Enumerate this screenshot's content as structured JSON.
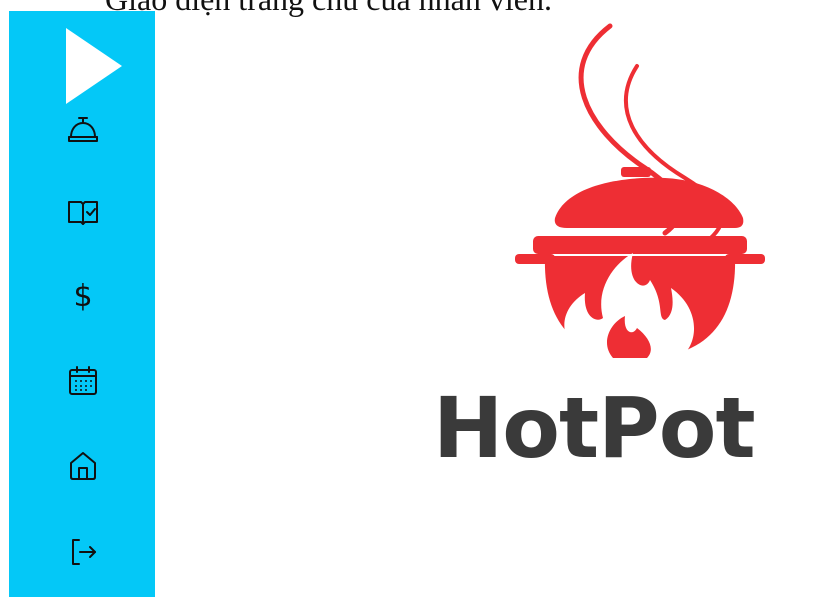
{
  "caption": "Giao diện trang chủ của nhân viên.",
  "sidebar": {
    "background": "#04c8f7",
    "toggle": {
      "icon": "play-triangle-icon"
    },
    "items": [
      {
        "name": "service",
        "icon": "service-bell-icon"
      },
      {
        "name": "menu",
        "icon": "menu-book-check-icon"
      },
      {
        "name": "payment",
        "icon": "dollar-sign-icon",
        "glyph": "$"
      },
      {
        "name": "calendar",
        "icon": "calendar-icon"
      },
      {
        "name": "home",
        "icon": "home-icon"
      },
      {
        "name": "logout",
        "icon": "logout-icon"
      }
    ]
  },
  "logo": {
    "brand": "HotPot",
    "accent": "#ee2e34",
    "text_color": "#3a3a3a"
  }
}
